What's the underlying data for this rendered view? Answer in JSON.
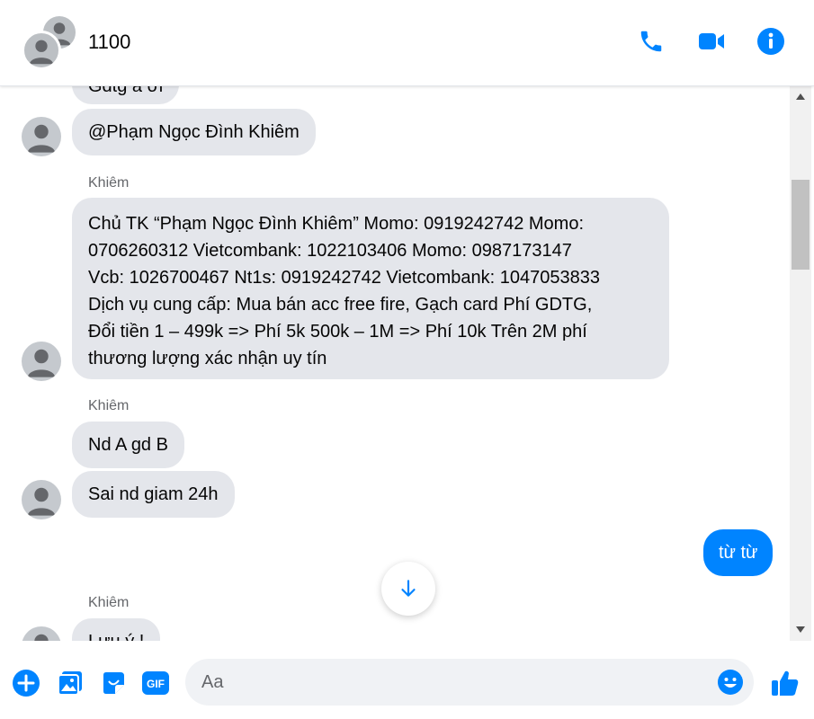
{
  "header": {
    "title": "1100",
    "icons": [
      "phone-icon",
      "video-icon",
      "info-icon"
    ]
  },
  "messages": [
    {
      "type": "incoming",
      "text": "Gdtg a ơi"
    },
    {
      "type": "incoming",
      "text": "@Phạm Ngọc Đình Khiêm"
    },
    {
      "type": "incoming",
      "sender": "Khiêm",
      "lines": [
        "Chủ TK “Phạm Ngọc Đình Khiêm”  Momo: 0919242742 Momo:",
        "0706260312 Vietcombank: 1022103406 Momo: 0987173147",
        "Vcb: 1026700467 Nt1s: 0919242742 Vietcombank: 1047053833",
        "Dịch vụ cung cấp:  Mua bán acc free fire, Gạch card Phí GDTG,",
        "Đổi tiền 1 – 499k => Phí 5k 500k – 1M => Phí 10k Trên 2M phí",
        "thương lượng xác nhận uy tín"
      ]
    },
    {
      "type": "incoming",
      "sender": "Khiêm",
      "text": "Nd A gd B"
    },
    {
      "type": "incoming",
      "text": "Sai nd giam 24h"
    },
    {
      "type": "outgoing",
      "text": "từ từ"
    },
    {
      "type": "incoming",
      "sender": "Khiêm",
      "text": "Lưu ý !"
    }
  ],
  "composer": {
    "placeholder": "Aa",
    "icons": [
      "plus-icon",
      "image-icon",
      "sticker-icon",
      "gif-icon",
      "emoji-icon",
      "like-icon"
    ],
    "gif_label": "GIF"
  },
  "colors": {
    "accent": "#0084ff",
    "bubble_incoming": "#e4e6eb"
  }
}
